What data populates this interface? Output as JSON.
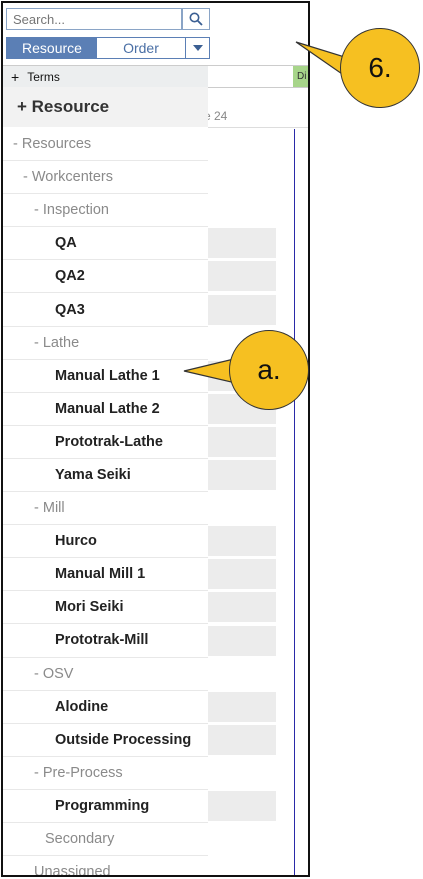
{
  "search": {
    "placeholder": "Search..."
  },
  "tabs": {
    "resource": "Resource",
    "order": "Order"
  },
  "terms": {
    "plus": "+",
    "label": "Terms",
    "green_label": "Di"
  },
  "panel": {
    "header": "+ Resource"
  },
  "gantt": {
    "date_label": "e 24"
  },
  "tree": [
    {
      "label": "Resources",
      "kind": "group",
      "prefix": "- "
    },
    {
      "label": "Workcenters",
      "kind": "group",
      "prefix": "- "
    },
    {
      "label": "Inspection",
      "kind": "group",
      "prefix": "- "
    },
    {
      "label": "QA",
      "kind": "leaf",
      "prefix": ""
    },
    {
      "label": "QA2",
      "kind": "leaf",
      "prefix": ""
    },
    {
      "label": "QA3",
      "kind": "leaf",
      "prefix": ""
    },
    {
      "label": "Lathe",
      "kind": "group",
      "prefix": "- "
    },
    {
      "label": "Manual Lathe 1",
      "kind": "leaf",
      "prefix": ""
    },
    {
      "label": "Manual Lathe 2",
      "kind": "leaf",
      "prefix": ""
    },
    {
      "label": "Prototrak-Lathe",
      "kind": "leaf",
      "prefix": ""
    },
    {
      "label": "Yama Seiki",
      "kind": "leaf",
      "prefix": ""
    },
    {
      "label": "Mill",
      "kind": "group",
      "prefix": "- "
    },
    {
      "label": "Hurco",
      "kind": "leaf",
      "prefix": ""
    },
    {
      "label": "Manual Mill 1",
      "kind": "leaf",
      "prefix": ""
    },
    {
      "label": "Mori Seiki",
      "kind": "leaf",
      "prefix": ""
    },
    {
      "label": "Prototrak-Mill",
      "kind": "leaf",
      "prefix": ""
    },
    {
      "label": "OSV",
      "kind": "group",
      "prefix": "- "
    },
    {
      "label": "Alodine",
      "kind": "leaf",
      "prefix": ""
    },
    {
      "label": "Outside Processing",
      "kind": "leaf",
      "prefix": ""
    },
    {
      "label": "Pre-Process",
      "kind": "group",
      "prefix": "- "
    },
    {
      "label": "Programming",
      "kind": "leaf",
      "prefix": ""
    },
    {
      "label": "Secondary",
      "kind": "group",
      "prefix": ""
    },
    {
      "label": "Unassigned",
      "kind": "group",
      "prefix": ""
    }
  ],
  "callouts": {
    "six": "6.",
    "a": "a."
  },
  "colors": {
    "tab_active": "#5b7fb5",
    "callout": "#f6c021",
    "now_line": "#2a2aa8",
    "terms_green": "#a7d58a"
  }
}
